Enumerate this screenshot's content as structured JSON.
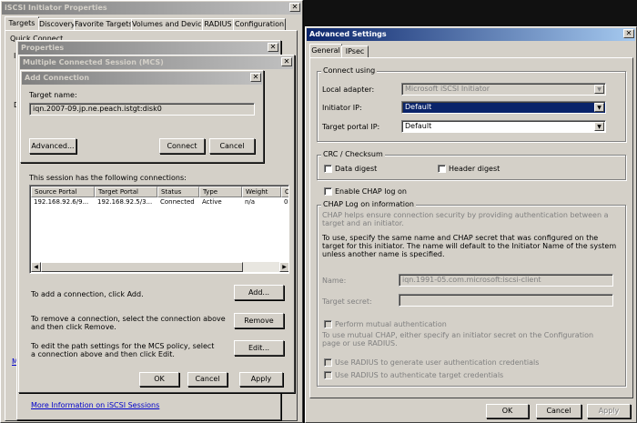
{
  "iscsi_props": {
    "title": "iSCSI Initiator Properties",
    "tabs": [
      "Targets",
      "Discovery",
      "Favorite Targets",
      "Volumes and Devices",
      "RADIUS",
      "Configuration"
    ],
    "quick_connect_label": "Quick Connect",
    "side_letters": [
      "I",
      "D",
      "M"
    ]
  },
  "props_dialog": {
    "title": "Properties"
  },
  "mcs_dialog": {
    "title": "Multiple Connected Session (MCS)",
    "connections_label": "This session has the following connections:",
    "columns": [
      "Source Portal",
      "Target Portal",
      "Status",
      "Type",
      "Weight",
      "C"
    ],
    "rows": [
      {
        "source": "192.168.92.6/9...",
        "target": "192.168.92.5/3...",
        "status": "Connected",
        "type": "Active",
        "weight": "n/a",
        "c": "0"
      }
    ],
    "add_text": "To add a connection, click Add.",
    "add_button": "Add...",
    "remove_text": "To remove a connection, select the connection above and then click Remove.",
    "remove_button": "Remove",
    "edit_text": "To edit the path settings for the MCS policy, select a connection above and then click Edit.",
    "edit_button": "Edit...",
    "ok": "OK",
    "cancel": "Cancel",
    "apply": "Apply",
    "more_info_link": "More Information on iSCSI Sessions"
  },
  "add_connection": {
    "title": "Add Connection",
    "target_name_label": "Target name:",
    "target_name_value": "iqn.2007-09.jp.ne.peach.istgt:disk0",
    "advanced_button": "Advanced...",
    "connect_button": "Connect",
    "cancel_button": "Cancel"
  },
  "advanced": {
    "title": "Advanced Settings",
    "tabs": [
      "General",
      "IPsec"
    ],
    "connect_using_label": "Connect using",
    "local_adapter_label": "Local adapter:",
    "local_adapter_value": "Microsoft iSCSI Initiator",
    "initiator_ip_label": "Initiator IP:",
    "initiator_ip_value": "Default",
    "target_portal_label": "Target portal IP:",
    "target_portal_value": "Default",
    "crc_label": "CRC / Checksum",
    "data_digest": "Data digest",
    "header_digest": "Header digest",
    "enable_chap": "Enable CHAP log on",
    "chap_group_label": "CHAP Log on information",
    "chap_help": "CHAP helps ensure connection security by providing authentication between a target and an initiator.",
    "chap_instructions": "To use, specify the same name and CHAP secret that was configured on the target for this initiator.  The name will default to the Initiator Name of the system unless another name is specified.",
    "name_label": "Name:",
    "name_value": "iqn.1991-05.com.microsoft:iscsi-client",
    "secret_label": "Target secret:",
    "mutual_auth": "Perform mutual authentication",
    "mutual_help": "To use mutual CHAP, either specify an initiator secret on the Configuration page or use RADIUS.",
    "radius_user": "Use RADIUS to generate user authentication credentials",
    "radius_target": "Use RADIUS to authenticate target credentials",
    "ok": "OK",
    "cancel": "Cancel",
    "apply": "Apply"
  }
}
